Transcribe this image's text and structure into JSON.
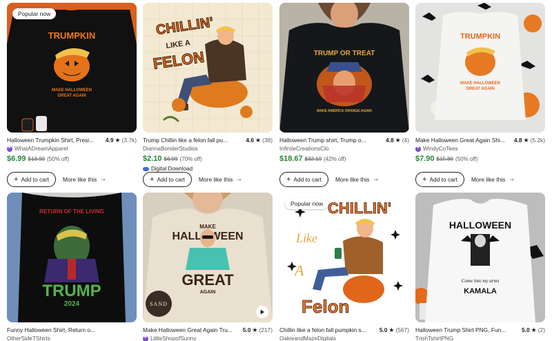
{
  "products": [
    {
      "badge": "Popular now",
      "title": "Halloween Trumpkin Shirt, Presi...",
      "rating": "4.9",
      "count": "(3.7k)",
      "shop": "WhatADreamApparel",
      "star_seller": true,
      "price": "$6.99",
      "old_price": "$13.99",
      "discount": "(50% off)",
      "cart_label": "Add to cart",
      "more_label": "More like this",
      "design_text": [
        "TRUMPKIN",
        "MAKE HALLOWEEN",
        "GREAT AGAIN"
      ],
      "shirt_color": "#101010"
    },
    {
      "title": "Trump Chillin like a felon fall pu...",
      "rating": "4.6",
      "count": "(38)",
      "shop": "DiannaBonderStudios",
      "star_seller": false,
      "price": "$2.10",
      "old_price": "$6.99",
      "discount": "(70% off)",
      "digital_label": "Digital Download",
      "cart_label": "Add to cart",
      "more_label": "More like this",
      "design_text": [
        "CHILLIN'",
        "LIKE A",
        "FELON"
      ]
    },
    {
      "title": "Halloween Trump shirt, Trump o...",
      "rating": "4.8",
      "count": "(4)",
      "shop": "InfiniteCreationsClo",
      "star_seller": false,
      "price": "$18.67",
      "old_price": "$32.19",
      "discount": "(42% off)",
      "cart_label": "Add to cart",
      "more_label": "More like this",
      "design_text": [
        "TRUMP OR TREAT",
        "MAKE AMERICA ORANGE AGAIN"
      ],
      "shirt_color": "#15181a"
    },
    {
      "title": "Make Halloween Great Again Shi...",
      "rating": "4.8",
      "count": "(5.2k)",
      "shop": "WindyCoTees",
      "star_seller": true,
      "price": "$7.90",
      "old_price": "$15.80",
      "discount": "(50% off)",
      "cart_label": "Add to cart",
      "more_label": "More like this",
      "design_text": [
        "TRUMPKIN",
        "MAKE HALLOWEEN",
        "GREAT AGAIN"
      ],
      "shirt_color": "#f2f2f0"
    },
    {
      "title": "Funny Halloween Shirt, Return o...",
      "shop": "OtherSideTShirts",
      "star_seller": false,
      "design_text": [
        "RETURN OF THE LIVING",
        "TRUMP",
        "2024"
      ],
      "shirt_color": "#0d0d0d"
    },
    {
      "title": "Make Halloween Great Again Tru...",
      "rating": "5.0",
      "count": "(217)",
      "shop": "LittleShopofSunny",
      "star_seller": true,
      "seal_text": "SAND",
      "design_text": [
        "MAKE",
        "HALLOWEEN",
        "GREAT",
        "AGAIN"
      ],
      "shirt_color": "#e9e0cf"
    },
    {
      "badge": "Popular now",
      "title": "Chillin like a felon fall pumpkin s...",
      "rating": "5.0",
      "count": "(567)",
      "shop": "OakieandMazeDigitals",
      "star_seller": false,
      "design_text": [
        "CHILLIN'",
        "Like",
        "A",
        "Felon"
      ]
    },
    {
      "title": "Halloween Trump Shirt PNG, Fun...",
      "rating": "5.0",
      "count": "(2)",
      "shop": "TrishTshirtPNG",
      "star_seller": false,
      "design_text": [
        "HALLOWEEN",
        "Come into my arms",
        "KAMALA"
      ],
      "shirt_color": "#f7f7f7"
    }
  ],
  "icons": {
    "star": "star-icon",
    "plus": "plus-icon",
    "arrow": "arrow-right-icon",
    "play": "play-icon",
    "shop_badge": "star-seller-icon",
    "digital": "cloud-download-icon"
  },
  "colors": {
    "price_green": "#258635",
    "star_seller_purple": "#7b4fd6",
    "text": "#222222",
    "muted": "#595959"
  }
}
